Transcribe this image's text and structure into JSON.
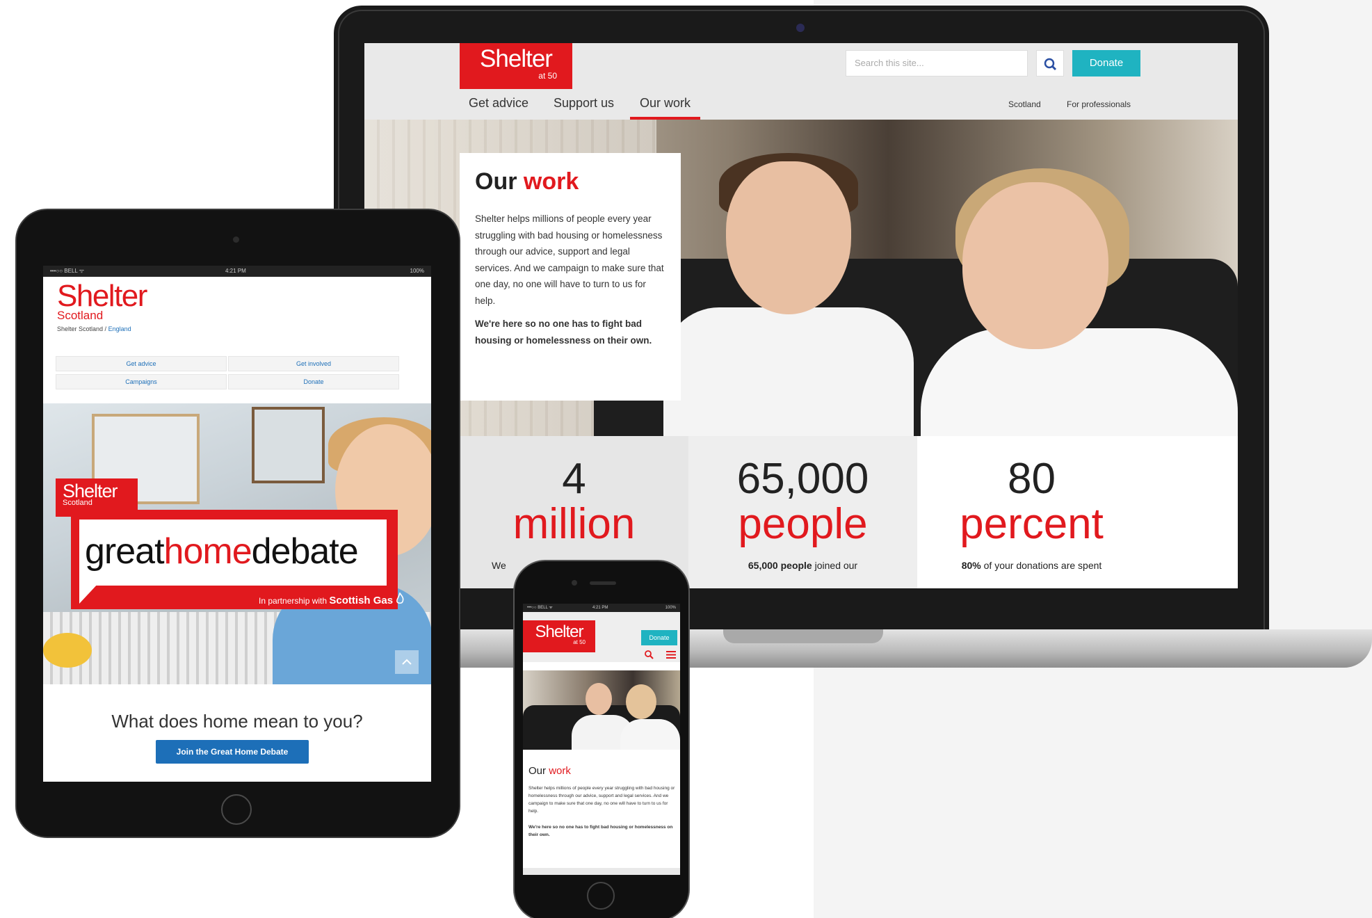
{
  "laptop": {
    "logo": {
      "name": "Shelter",
      "tagline": "at 50"
    },
    "search": {
      "placeholder": "Search this site..."
    },
    "donate_label": "Donate",
    "nav": [
      "Get advice",
      "Support us",
      "Our work"
    ],
    "nav_secondary": [
      "Scotland",
      "For professionals"
    ],
    "card": {
      "title_plain": "Our",
      "title_accent": "work",
      "body": "Shelter helps millions of people every year struggling with bad housing or homelessness through our advice, support and legal services. And we campaign to make sure that one day, no one will have to turn to us for help.",
      "emphasis": "We're here so no one has to fight bad housing or homelessness on their own."
    },
    "stats": [
      {
        "number": "4",
        "word": "million",
        "caption": "We"
      },
      {
        "number": "65,000",
        "word": "people",
        "caption_bold": "65,000 people",
        "caption": "joined our"
      },
      {
        "number": "80",
        "word": "percent",
        "caption_bold": "80%",
        "caption": "of your donations are spent"
      }
    ]
  },
  "tablet": {
    "status": {
      "carrier": "•••○○ BELL ᯤ",
      "time": "4:21 PM",
      "battery": "100%"
    },
    "logo": {
      "name": "Shelter",
      "region": "Scotland"
    },
    "breadcrumb": {
      "current": "Shelter Scotland",
      "separator": " / ",
      "link": "England"
    },
    "menu": [
      "Get advice",
      "Get involved",
      "Campaigns",
      "Donate"
    ],
    "campaign": {
      "logo_name": "Shelter",
      "logo_region": "Scotland",
      "title_a": "great",
      "title_b": "home",
      "title_c": "debate",
      "partner_prefix": "In partnership with",
      "partner_name": "Scottish Gas"
    },
    "question": "What does home mean to you?",
    "cta": "Join the Great Home Debate"
  },
  "phone": {
    "status": {
      "carrier": "•••○○ BELL ᯤ",
      "time": "4:21 PM",
      "battery": "100%"
    },
    "logo": {
      "name": "Shelter",
      "tagline": "at 50"
    },
    "donate_label": "Donate",
    "title_plain": "Our",
    "title_accent": "work",
    "body": "Shelter helps millions of people every year struggling with bad housing or homelessness through our advice, support and legal services. And we campaign to make sure that one day, no one will have to turn to us for help.",
    "emphasis": "We're here so no one has to fight bad housing or homelessness on their own."
  },
  "colors": {
    "brand_red": "#e1191e",
    "donate_teal": "#1fb3c1",
    "link_blue": "#1d6fb8"
  },
  "icons": [
    "search-icon",
    "menu-icon",
    "scroll-up-icon",
    "flame-icon"
  ]
}
